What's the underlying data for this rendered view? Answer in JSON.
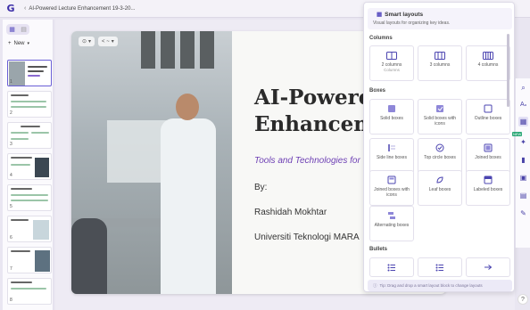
{
  "app": {
    "logo": "G",
    "doc_title": "AI-Powered Lecture Enhancement 19-3-20..."
  },
  "left_panel": {
    "new_label": "New",
    "thumb_numbers": [
      "1",
      "2",
      "3",
      "4",
      "5",
      "6",
      "7",
      "8"
    ]
  },
  "slide_tools": {
    "tool1": "⊙",
    "tool2": "< ~"
  },
  "slide": {
    "title_line1": "AI-Powere",
    "title_line2": "Enhancem",
    "subtitle": "Tools and Technologies for",
    "by": "By:",
    "author": "Rashidah Mokhtar",
    "institution": "Universiti Teknologi MARA"
  },
  "smart_layouts": {
    "title": "Smart layouts",
    "description": "Visual layouts for organizing key ideas.",
    "sections": {
      "columns": "Columns",
      "boxes": "Boxes",
      "bullets": "Bullets"
    },
    "columns": [
      {
        "label": "2 columns",
        "note": "Columns"
      },
      {
        "label": "3 columns"
      },
      {
        "label": "4 columns"
      }
    ],
    "boxes": [
      {
        "label": "Solid boxes"
      },
      {
        "label": "Solid boxes with icons"
      },
      {
        "label": "Outline boxes"
      },
      {
        "label": "Side line boxes"
      },
      {
        "label": "Top circle boxes"
      },
      {
        "label": "Joined boxes"
      },
      {
        "label": "Joined boxes with icons"
      },
      {
        "label": "Leaf boxes"
      },
      {
        "label": "Labeled boxes"
      },
      {
        "label": "Alternating boxes"
      }
    ],
    "footer": "Tip: Drag and drop a smart layout block to change layouts"
  },
  "right_toolbar": {
    "icons": [
      "search-icon",
      "text-icon",
      "layout-icon",
      "sparkle-icon",
      "chart-icon",
      "image-icon",
      "table-icon",
      "edit-icon"
    ],
    "new_badge": "NEW"
  },
  "help": "?"
}
